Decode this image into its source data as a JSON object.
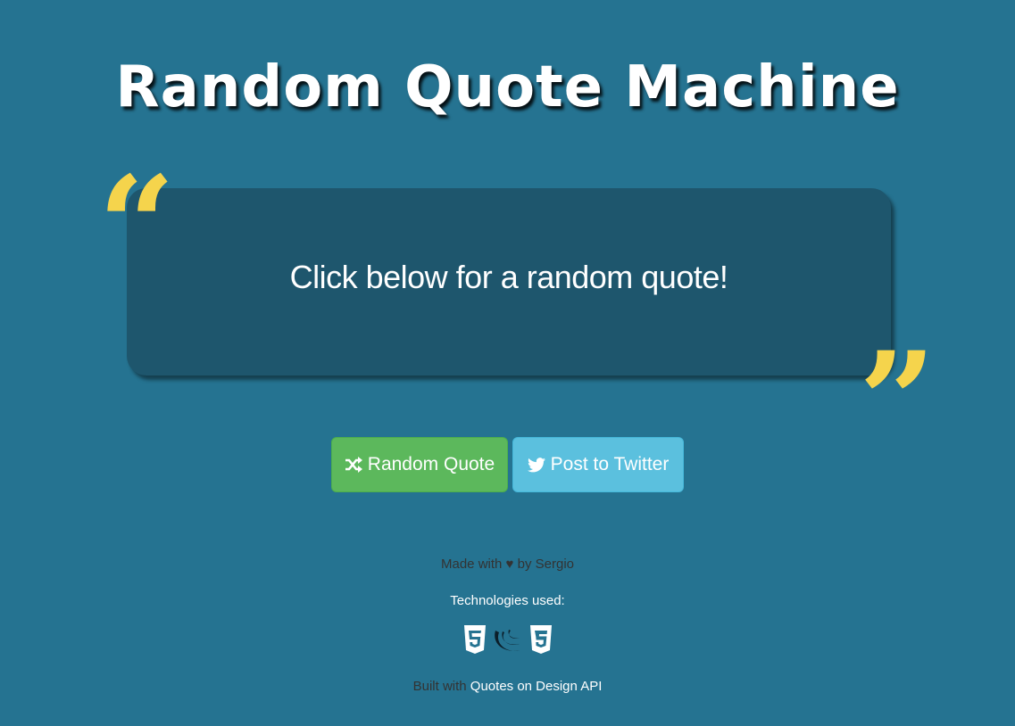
{
  "header": {
    "title": "Random Quote Machine"
  },
  "quote_box": {
    "open_mark": "“",
    "text": "Click below for a random quote!",
    "close_mark": "”"
  },
  "buttons": {
    "random_label": "Random Quote",
    "random_icon": "shuffle-icon",
    "twitter_label": "Post to Twitter",
    "twitter_icon": "twitter-icon"
  },
  "footer": {
    "made_prefix": "Made with",
    "heart": "♥",
    "made_suffix": "by Sergio",
    "technologies_label": "Technologies used:",
    "tech_icons": [
      "html5-icon",
      "jquery-icon",
      "css3-icon"
    ],
    "built_prefix": "Built with",
    "built_link": "Quotes on Design API"
  },
  "colors": {
    "background": "#257391",
    "quote_box": "#1e566d",
    "quote_marks": "#f5d44c",
    "random_button": "#5cb85c",
    "twitter_button": "#5bc0de"
  }
}
